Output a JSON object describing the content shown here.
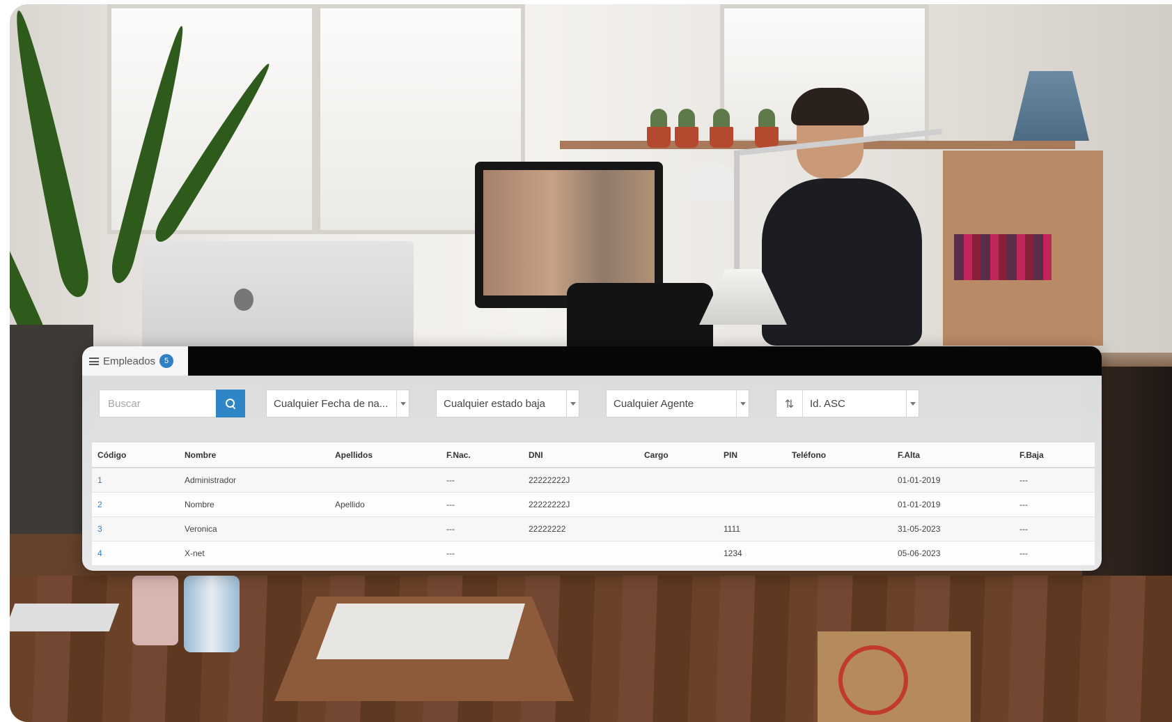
{
  "tab": {
    "label": "Empleados",
    "badge": "5"
  },
  "search": {
    "placeholder": "Buscar",
    "value": ""
  },
  "filters": {
    "birth_date": "Cualquier Fecha de na...",
    "status": "Cualquier estado baja",
    "agent": "Cualquier Agente",
    "sort": "Id. ASC"
  },
  "table": {
    "columns": [
      "Código",
      "Nombre",
      "Apellidos",
      "F.Nac.",
      "DNI",
      "Cargo",
      "PIN",
      "Teléfono",
      "F.Alta",
      "F.Baja"
    ],
    "rows": [
      [
        "1",
        "Administrador",
        "",
        "---",
        "22222222J",
        "",
        "",
        "",
        "01-01-2019",
        "---"
      ],
      [
        "2",
        "Nombre",
        "Apellido",
        "---",
        "22222222J",
        "",
        "",
        "",
        "01-01-2019",
        "---"
      ],
      [
        "3",
        "Veronica",
        "",
        "---",
        "22222222",
        "",
        "1111",
        "",
        "31-05-2023",
        "---"
      ],
      [
        "4",
        "X-net",
        "",
        "---",
        "",
        "",
        "1234",
        "",
        "05-06-2023",
        "---"
      ]
    ]
  },
  "colors": {
    "accent": "#2f7fc3",
    "tabbar": "#060606"
  }
}
